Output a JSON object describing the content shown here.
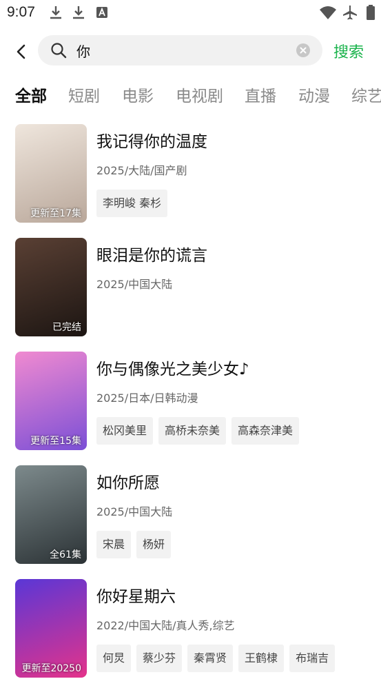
{
  "status_bar": {
    "time": "9:07"
  },
  "search": {
    "query": "你",
    "button_label": "搜索"
  },
  "tabs": [
    "全部",
    "短剧",
    "电影",
    "电视剧",
    "直播",
    "动漫",
    "综艺"
  ],
  "results": [
    {
      "title": "我记得你的温度",
      "meta": "2025/大陆/国产剧",
      "tags": [
        "李明峻 秦杉"
      ],
      "badge": "更新至17集",
      "poster_colors": [
        "#efe6dd",
        "#b9a79a"
      ]
    },
    {
      "title": "眼泪是你的谎言",
      "meta": "2025/中国大陆",
      "tags": [],
      "badge": "已完结",
      "poster_colors": [
        "#5a4034",
        "#1c1512"
      ]
    },
    {
      "title": "你与偶像光之美少女♪",
      "meta": "2025/日本/日韩动漫",
      "tags": [
        "松冈美里",
        "高桥未奈美",
        "高森奈津美"
      ],
      "badge": "更新至15集",
      "poster_colors": [
        "#f08ad0",
        "#7b4fd6"
      ]
    },
    {
      "title": "如你所愿",
      "meta": "2025/中国大陆",
      "tags": [
        "宋晨",
        "杨妍"
      ],
      "badge": "全61集",
      "poster_colors": [
        "#7d8a8c",
        "#2b3235"
      ]
    },
    {
      "title": "你好星期六",
      "meta": "2022/中国大陆/真人秀,综艺",
      "tags": [
        "何炅",
        "蔡少芬",
        "秦霄贤",
        "王鹤棣",
        "布瑞吉"
      ],
      "badge": "更新至20250",
      "poster_colors": [
        "#5a37d6",
        "#e4338a"
      ]
    }
  ]
}
